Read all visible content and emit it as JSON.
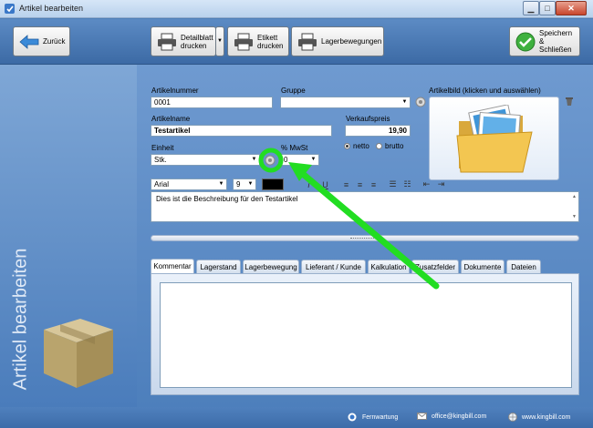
{
  "window": {
    "title": "Artikel bearbeiten"
  },
  "toolbar": {
    "back_label": "Zurück",
    "detail_print_line1": "Detailblatt",
    "detail_print_line2": "drucken",
    "label_print_line1": "Etikett",
    "label_print_line2": "drucken",
    "stock_movements_label": "Lagerbewegungen",
    "save_close_line1": "Speichern",
    "save_close_line2": "& Schließen"
  },
  "sidebar": {
    "vertical_title": "Artikel bearbeiten"
  },
  "form": {
    "article_number_label": "Artikelnummer",
    "article_number_value": "0001",
    "group_label": "Gruppe",
    "group_value": "",
    "article_image_label": "Artikelbild (klicken und auswählen)",
    "article_name_label": "Artikelname",
    "article_name_value": "Testartikel",
    "sales_price_label": "Verkaufspreis",
    "sales_price_value": "19,90",
    "netto_label": "netto",
    "brutto_label": "brutto",
    "unit_label": "Einheit",
    "unit_value": "Stk.",
    "vat_label": "% MwSt",
    "vat_value": "0",
    "font_family": "Arial",
    "font_size": "9",
    "description": "Dies ist die Beschreibung für den Testartikel"
  },
  "tabs": [
    "Kommentar",
    "Lagerstand",
    "Lagerbewegung",
    "Lieferant / Kunde",
    "Kalkulation",
    "Zusatzfelder",
    "Dokumente",
    "Dateien"
  ],
  "status": {
    "remote_label": "Fernwartung",
    "email_label": "office@kingbill.com",
    "web_label": "www.kingbill.com"
  },
  "colors": {
    "highlight": "#22dd22",
    "accent": "#4d7eb8"
  }
}
